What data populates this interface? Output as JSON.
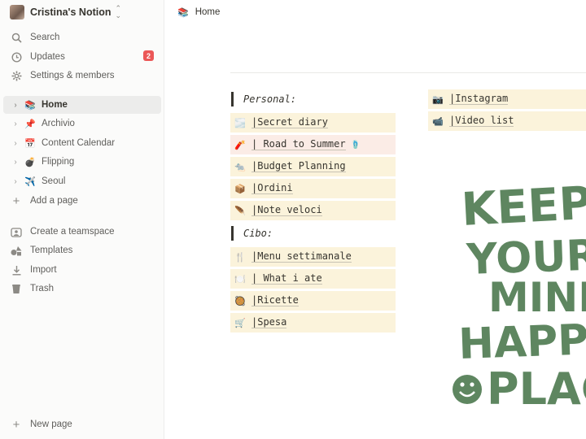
{
  "workspace": {
    "name": "Cristina's Notion"
  },
  "nav": {
    "search": "Search",
    "updates": "Updates",
    "updates_badge": "2",
    "settings": "Settings & members"
  },
  "pages": [
    {
      "label": "Home",
      "icon": "📚"
    },
    {
      "label": "Archivio",
      "icon": "📌"
    },
    {
      "label": "Content Calendar",
      "icon": "📅"
    },
    {
      "label": "Flipping",
      "icon": "💣"
    },
    {
      "label": "Seoul",
      "icon": "✈️"
    }
  ],
  "sidebar_actions": {
    "add_page": "Add a page",
    "create_teamspace": "Create a teamspace",
    "templates": "Templates",
    "import": "Import",
    "trash": "Trash",
    "new_page": "New page"
  },
  "breadcrumb": {
    "icon": "📚",
    "label": "Home"
  },
  "sections": {
    "personal": {
      "heading": "Personal:",
      "links": [
        {
          "icon": "🌫️",
          "label": "|Secret diary"
        },
        {
          "icon": "🧨",
          "label": "| Road to Summer",
          "tail": "🩴"
        },
        {
          "icon": "🐀",
          "label": "|Budget Planning"
        },
        {
          "icon": "📦",
          "label": "|Ordini"
        },
        {
          "icon": "🪶",
          "label": "|Note veloci"
        }
      ]
    },
    "cibo": {
      "heading": "Cibo:",
      "links": [
        {
          "icon": "🍴",
          "label": "|Menu settimanale"
        },
        {
          "icon": "🍽️",
          "label": "| What i ate"
        },
        {
          "icon": "🥘",
          "label": "|Ricette"
        },
        {
          "icon": "🛒",
          "label": "|Spesa"
        }
      ]
    },
    "social": {
      "links": [
        {
          "icon": "📷",
          "label": "|Instagram"
        },
        {
          "icon": "📹",
          "label": "|Video list"
        }
      ]
    }
  },
  "art": {
    "lines": [
      "KEEP",
      "YOUR",
      "MIND",
      "HAPPY",
      "PLAC"
    ],
    "color": "#5e8660"
  }
}
